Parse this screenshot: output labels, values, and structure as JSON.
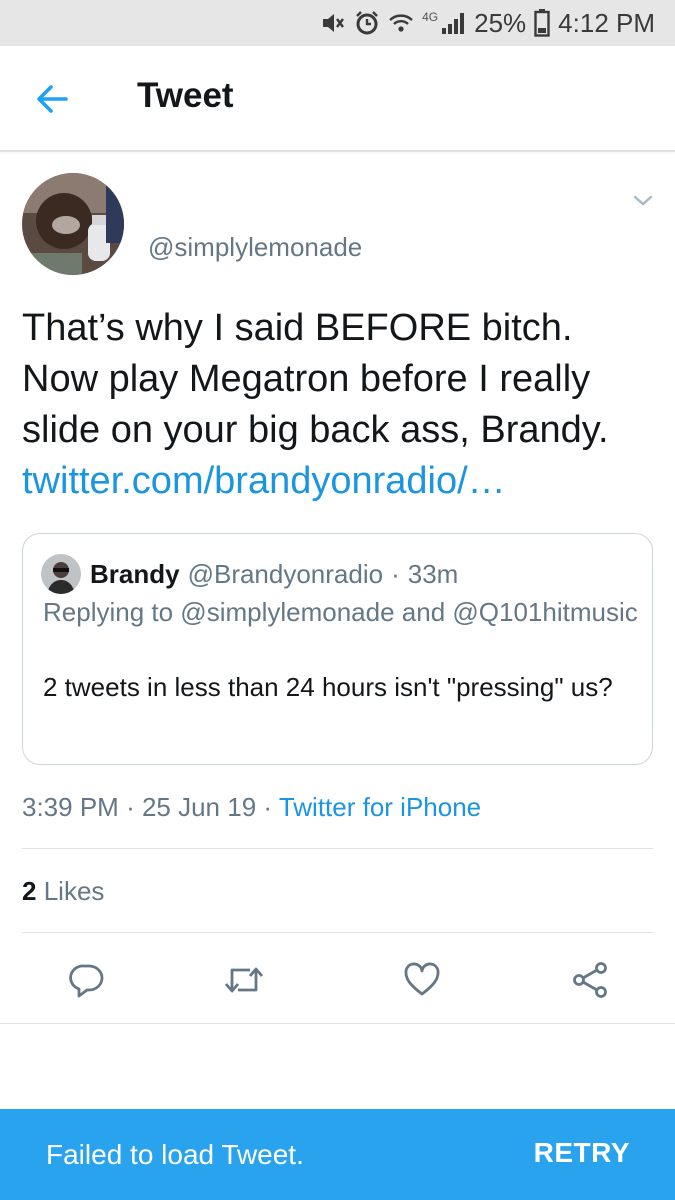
{
  "status_bar": {
    "network": "4G",
    "battery": "25%",
    "time": "4:12 PM",
    "icons": [
      "mute-icon",
      "alarm-icon",
      "wifi-icon",
      "signal-icon",
      "battery-icon"
    ]
  },
  "app_bar": {
    "title": "Tweet",
    "back_icon": "arrow-left-icon"
  },
  "tweet": {
    "handle": "@simplylemonade",
    "text_lines": [
      "That’s why I said BEFORE bitch.",
      "Now play Megatron before I really",
      "slide on your big back ass, Brandy."
    ],
    "link": "twitter.com/brandyonradio/…",
    "quoted": {
      "name": "Brandy",
      "handle": "@Brandyonradio",
      "separator": "·",
      "age": "33m",
      "reply_to": "Replying to @simplylemonade and @Q101hitmusic",
      "text": "2 tweets in less than 24 hours isn't \"pressing\" us?"
    },
    "time": "3:39 PM",
    "date": "25 Jun 19",
    "source": "Twitter for iPhone",
    "likes_count": "2",
    "likes_label": "Likes"
  },
  "actions": [
    "reply-icon",
    "retweet-icon",
    "like-icon",
    "share-icon"
  ],
  "snackbar": {
    "message": "Failed to load Tweet.",
    "action": "RETRY"
  },
  "colors": {
    "link": "#1b95e0",
    "secondary_text": "#657786",
    "snackbar": "#2aa3ef",
    "status_bar": "#e6e6e6"
  }
}
